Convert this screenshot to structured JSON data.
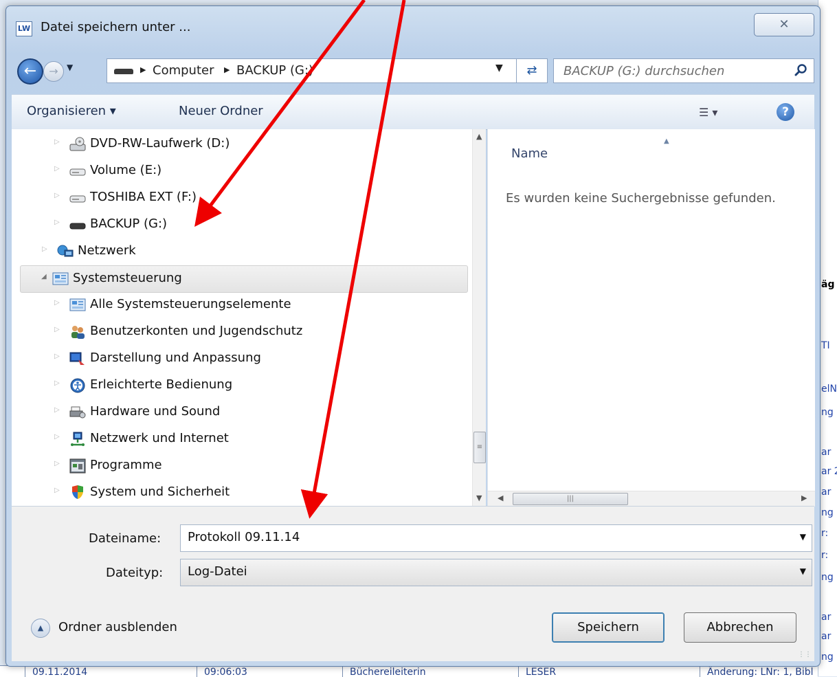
{
  "window": {
    "title": "Datei speichern unter ...",
    "close_glyph": "✕"
  },
  "address_bar": {
    "crumbs": [
      "Computer",
      "BACKUP (G:)"
    ]
  },
  "search": {
    "placeholder": "BACKUP (G:) durchsuchen"
  },
  "toolbar": {
    "organize_label": "Organisieren ▾",
    "new_folder_label": "Neuer Ordner"
  },
  "nav_tree": {
    "items": [
      {
        "label": "DVD-RW-Laufwerk (D:)",
        "icon": "dvd-drive-icon"
      },
      {
        "label": "Volume (E:)",
        "icon": "hard-drive-icon"
      },
      {
        "label": "TOSHIBA EXT (F:)",
        "icon": "hard-drive-icon"
      },
      {
        "label": "BACKUP (G:)",
        "icon": "removable-drive-icon"
      },
      {
        "label": "Netzwerk",
        "icon": "network-icon"
      },
      {
        "label": "Systemsteuerung",
        "icon": "control-panel-icon",
        "selected": true
      },
      {
        "label": "Alle Systemsteuerungselemente",
        "icon": "control-panel-icon"
      },
      {
        "label": "Benutzerkonten und Jugendschutz",
        "icon": "users-icon"
      },
      {
        "label": "Darstellung und Anpassung",
        "icon": "display-icon"
      },
      {
        "label": "Erleichterte Bedienung",
        "icon": "ease-of-access-icon"
      },
      {
        "label": "Hardware und Sound",
        "icon": "printer-icon"
      },
      {
        "label": "Netzwerk und Internet",
        "icon": "globe-network-icon"
      },
      {
        "label": "Programme",
        "icon": "programs-icon"
      },
      {
        "label": "System und Sicherheit",
        "icon": "security-icon"
      }
    ]
  },
  "file_list": {
    "column_name": "Name",
    "empty_message": "Es wurden keine Suchergebnisse gefunden."
  },
  "form": {
    "filename_label": "Dateiname:",
    "filename_value": "Protokoll 09.11.14",
    "filetype_label": "Dateityp:",
    "filetype_value": "Log-Datei",
    "hide_folders_label": "Ordner ausblenden",
    "save_label": "Speichern",
    "cancel_label": "Abbrechen"
  },
  "background_app": {
    "snippets": [
      "äg",
      "TI",
      "elN",
      "ng",
      "ar",
      "ar 2",
      "ar",
      "ng",
      "r:",
      "r:",
      "ng",
      "ar",
      "ar",
      "ng"
    ],
    "row": [
      "09.11.2014",
      "09:06:03",
      "Büchereileiterin",
      "LESER",
      "Änderung: LNr: 1, Bibl"
    ]
  },
  "colors": {
    "annotation_arrow": "#ee0000",
    "dialog_frame": "#bcd1ea",
    "accent_blue": "#1d56a8"
  }
}
